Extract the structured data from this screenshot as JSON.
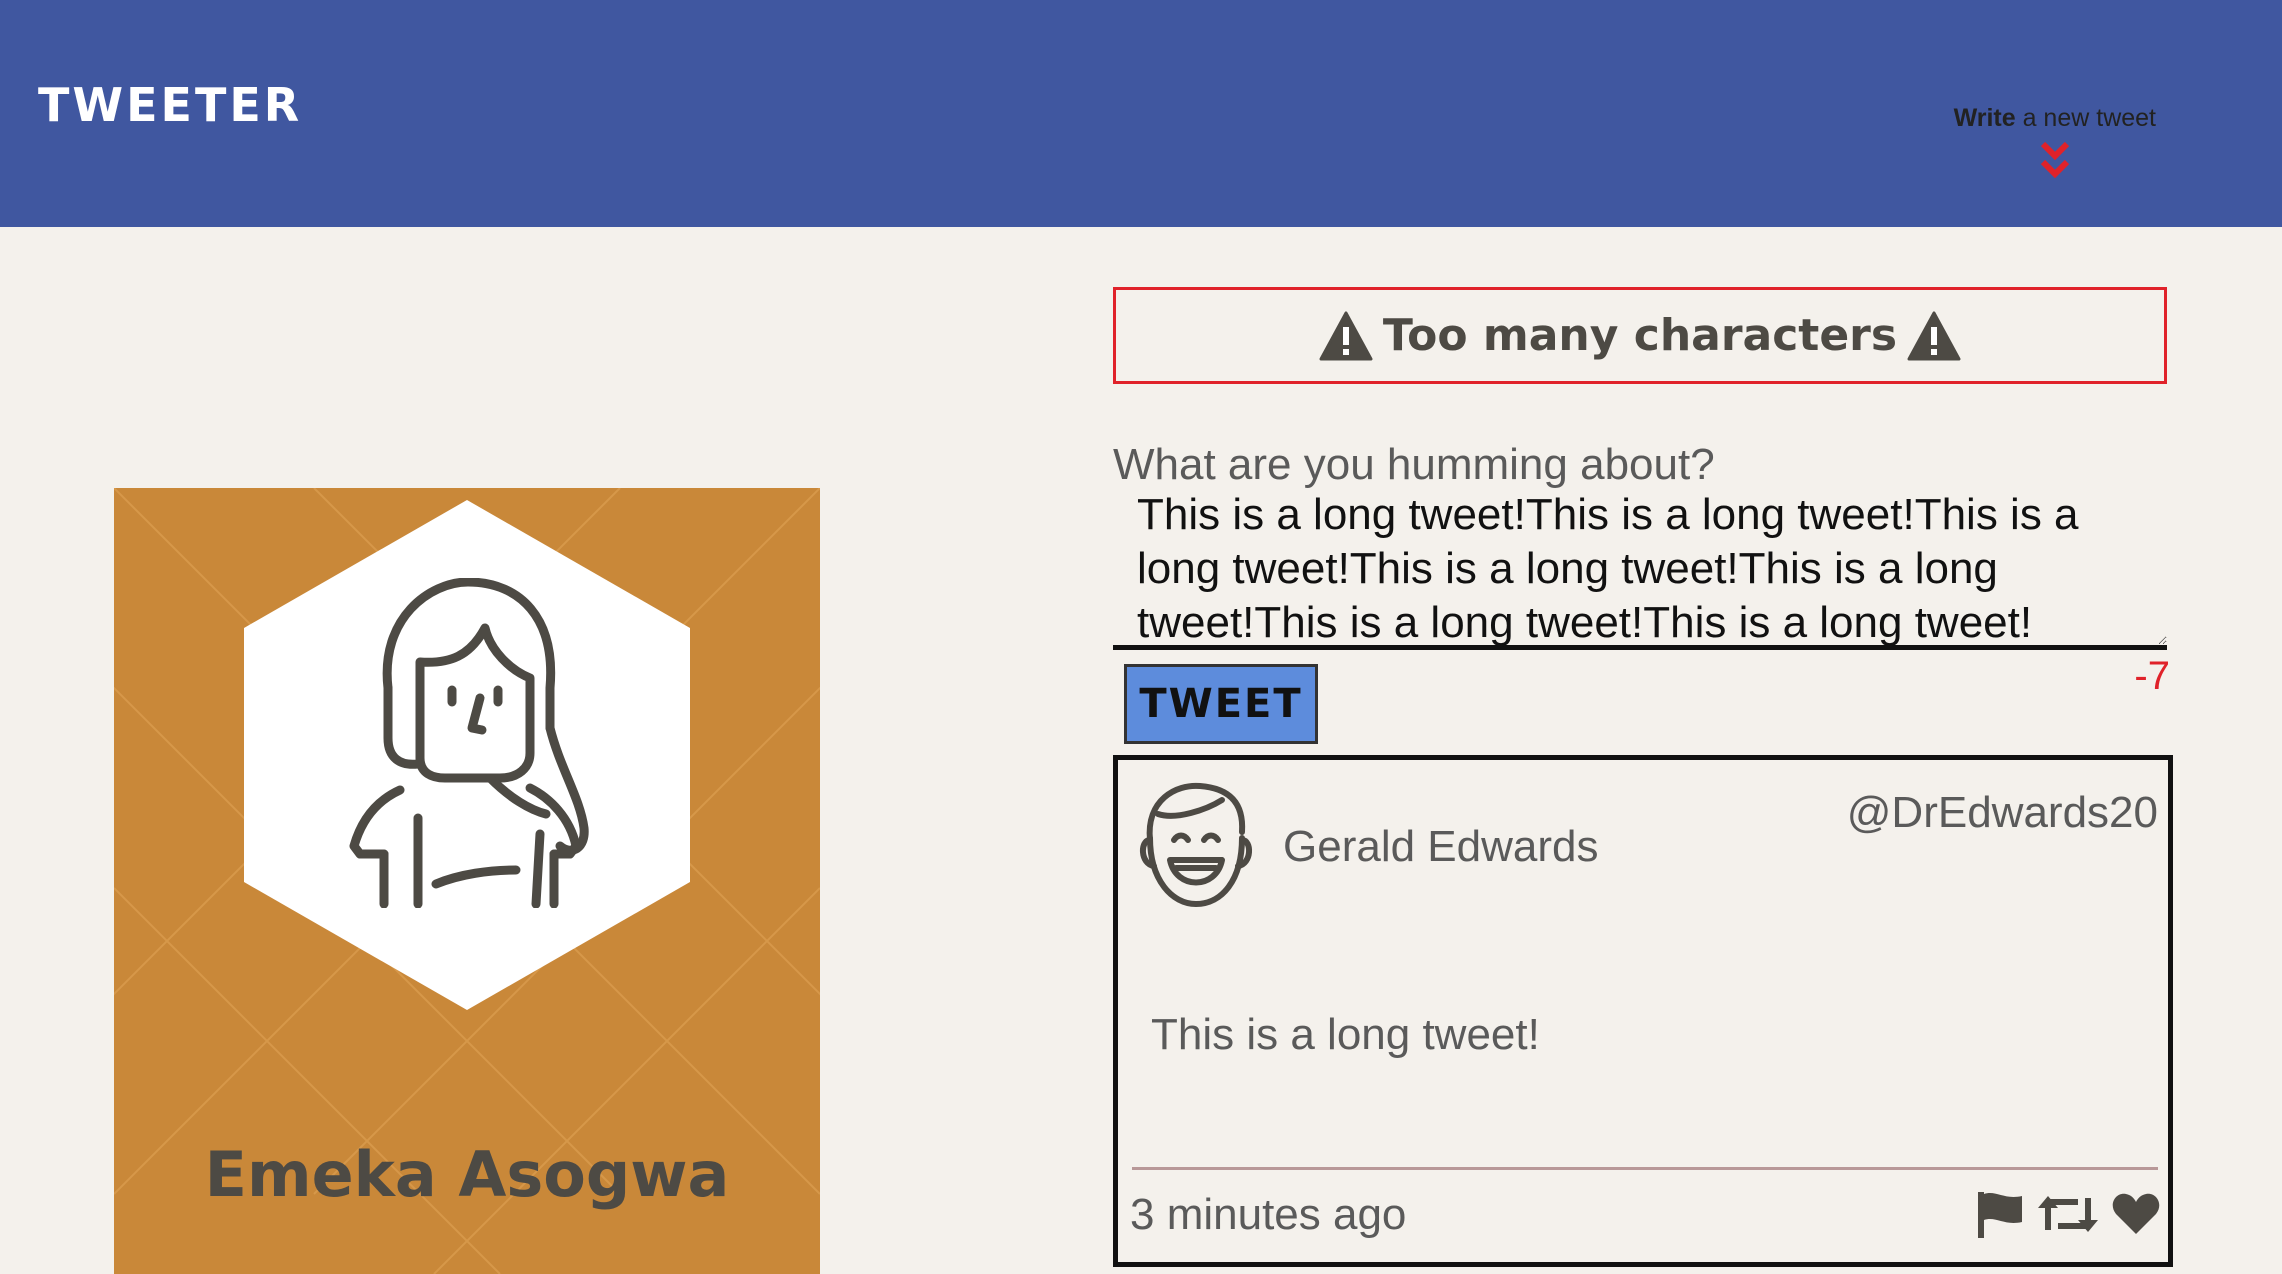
{
  "nav": {
    "brand": "TWEETER",
    "write_bold": "Write",
    "write_rest": " a new tweet",
    "chevron_icon": "double-chevron-down",
    "chevron_color": "#e0222a",
    "background_color": "#4057a0"
  },
  "profile": {
    "name": "Emeka Asogwa",
    "avatar_icon": "user-avatar-woman",
    "card_color": "#c98839"
  },
  "compose": {
    "error_message": "Too many characters",
    "error_icon": "warning-triangle-icon",
    "error_color": "#e0222a",
    "label": "What are you humming about?",
    "text": "This is a long tweet!This is a long tweet!This is a long tweet!This is a long tweet!This is a long tweet!This is a long tweet!This is a long tweet!",
    "button_label": "TWEET",
    "button_color": "#5d8cdc",
    "counter": "-7"
  },
  "tweets": [
    {
      "author_name": "Gerald Edwards",
      "handle": "@DrEdwards20",
      "avatar_icon": "smiling-man-avatar",
      "content": "This is a long tweet!",
      "time": "3 minutes ago",
      "actions": [
        "flag-icon",
        "retweet-icon",
        "heart-icon"
      ]
    }
  ]
}
